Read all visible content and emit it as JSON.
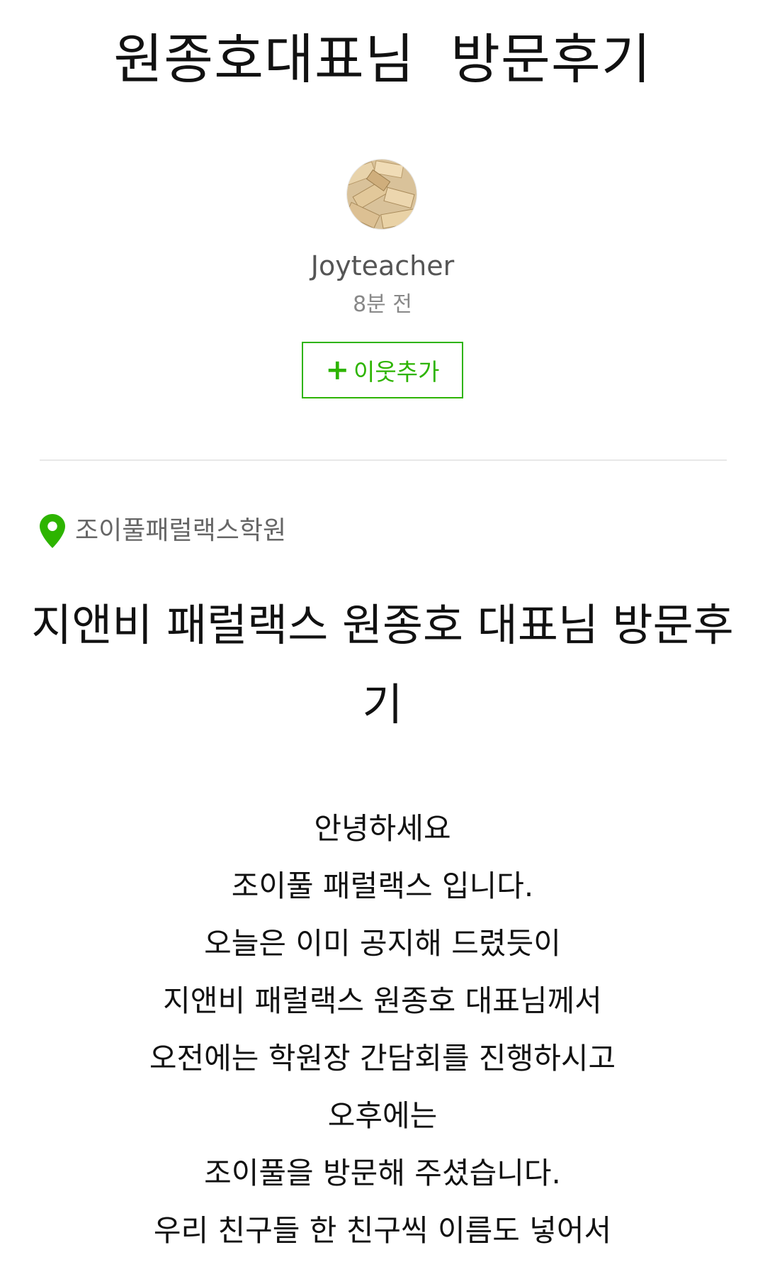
{
  "page_title": "원종호대표님  방문후기",
  "author": {
    "name": "Joyteacher",
    "time": "8분 전",
    "avatar_icon": "wooden-blocks-avatar"
  },
  "follow_button": {
    "plus": "+",
    "label": "이웃추가",
    "color": "#2db400"
  },
  "location": {
    "icon": "map-pin-icon",
    "label": "조이풀패럴랙스학원",
    "color": "#2db400"
  },
  "post": {
    "heading": "지앤비 패럴랙스 원종호 대표님 방문후기",
    "lines": [
      "안녕하세요",
      "조이풀 패럴랙스 입니다.",
      "오늘은 이미 공지해 드렸듯이",
      "지앤비 패럴랙스 원종호 대표님께서",
      "오전에는 학원장 간담회를 진행하시고",
      "오후에는",
      "조이풀을 방문해 주셨습니다.",
      "우리 친구들 한 친구씩 이름도 넣어서"
    ]
  }
}
